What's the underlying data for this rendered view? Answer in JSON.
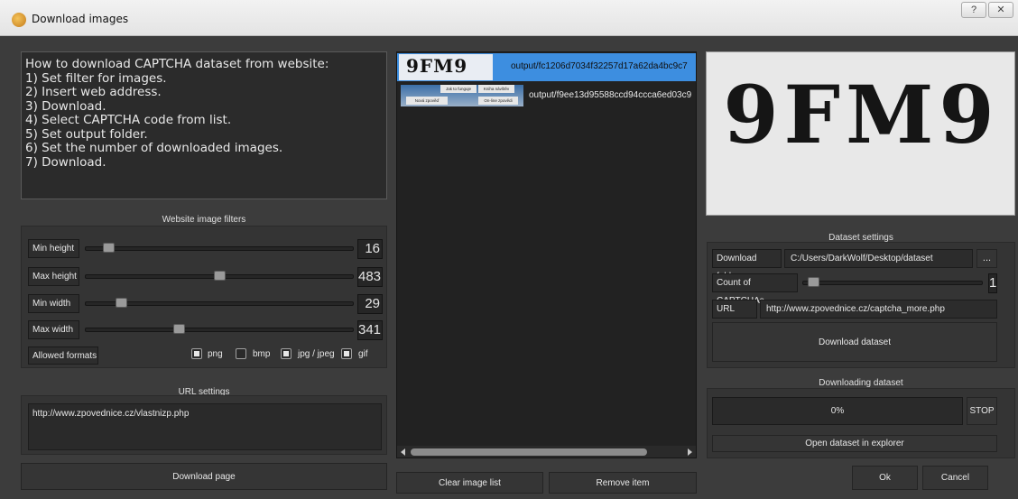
{
  "window": {
    "title": "Download images",
    "help_label": "?",
    "close_label": "✕"
  },
  "instructions": {
    "heading": "How to download CAPTCHA dataset from website:",
    "steps": [
      "1) Set filter for images.",
      "2) Insert web address.",
      "3) Download.",
      "4) Select CAPTCHA code from list.",
      "5) Set output folder.",
      "6) Set the number of downloaded images.",
      "7) Download."
    ]
  },
  "filters": {
    "title": "Website image filters",
    "min_height": {
      "label": "Min height",
      "value": "16",
      "level": 0.05
    },
    "max_height": {
      "label": "Max height",
      "value": "483",
      "level": 0.49
    },
    "min_width": {
      "label": "Min width",
      "value": "29",
      "level": 0.1
    },
    "max_width": {
      "label": "Max width",
      "value": "341",
      "level": 0.33
    },
    "allowed_formats_label": "Allowed formats",
    "formats": [
      {
        "label": "png",
        "checked": true
      },
      {
        "label": "bmp",
        "checked": false
      },
      {
        "label": "jpg / jpeg",
        "checked": true
      },
      {
        "label": "gif",
        "checked": true
      }
    ]
  },
  "url_settings": {
    "title": "URL settings",
    "url": "http://www.zpovednice.cz/vlastnizp.php"
  },
  "download_page_label": "Download page",
  "image_list": {
    "items": [
      {
        "thumb_text": "9FM9",
        "path": "output/fc1206d7034f32257d17a62da4bc9c7",
        "selected": true
      },
      {
        "thumb_lines": [
          "Jak to funguje",
          "Kniha návštěv",
          "Nová zpověď",
          "On-line zpovědi"
        ],
        "path": "output/f9ee13d95588ccd94ccca6ed03c9",
        "selected": false
      }
    ],
    "clear_label": "Clear image list",
    "remove_label": "Remove item"
  },
  "preview": {
    "text": "9FM9"
  },
  "dataset": {
    "title": "Dataset settings",
    "folder_label": "Download folder",
    "folder_value": "C:/Users/DarkWolf/Desktop/dataset",
    "browse_label": "...",
    "count_label": "Count of CAPTCHAs",
    "count_value": "1",
    "count_level": 0.0,
    "url_filter_label": "URL filter:",
    "url_filter_value": "http://www.zpovednice.cz/captcha_more.php",
    "download_label": "Download dataset"
  },
  "downloading": {
    "title": "Downloading dataset",
    "progress_text": "0%",
    "progress": 0.0,
    "stop_label": "STOP",
    "open_label": "Open dataset in explorer"
  },
  "footer": {
    "ok_label": "Ok",
    "cancel_label": "Cancel"
  }
}
